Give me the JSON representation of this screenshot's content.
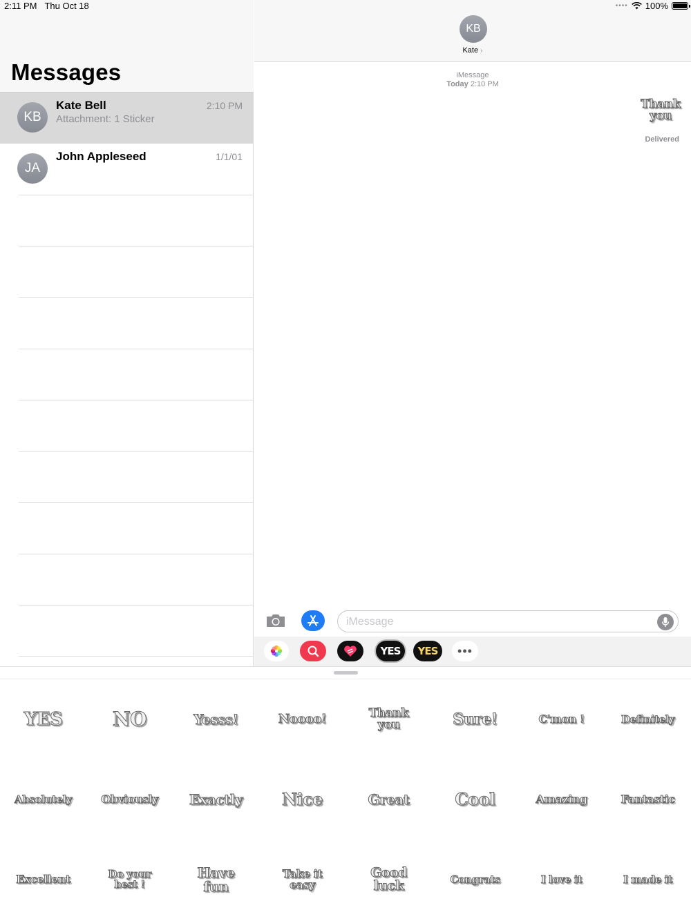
{
  "status": {
    "time": "2:11 PM",
    "date": "Thu Oct 18",
    "battery": "100%",
    "battery_level": 1.0
  },
  "sidebar": {
    "title": "Messages",
    "conversations": [
      {
        "initials": "KB",
        "name": "Kate Bell",
        "preview": "Attachment: 1 Sticker",
        "time": "2:10 PM",
        "selected": true
      },
      {
        "initials": "JA",
        "name": "John Appleseed",
        "preview": "",
        "time": "1/1/01",
        "selected": false
      }
    ]
  },
  "chat": {
    "contact_initials": "KB",
    "contact_name": "Kate",
    "service": "iMessage",
    "timestamp_day": "Today",
    "timestamp_time": "2:10 PM",
    "sticker_text": "Thank\nyou",
    "delivered": "Delivered"
  },
  "compose": {
    "placeholder": "iMessage"
  },
  "app_drawer": {
    "yes_1": "YES",
    "yes_2": "YES",
    "more": "•••"
  },
  "stickers": [
    "YES",
    "NO",
    "Yesss!",
    "Noooo!",
    "Thank\nyou",
    "Sure!",
    "C'mon !",
    "Definitely",
    "Absolutely",
    "Obviously",
    "Exactly",
    "Nice",
    "Great",
    "Cool",
    "Amazing",
    "Fantastic",
    "Excellent",
    "Do your\nbest !",
    "Have\nfun",
    "Take it\neasy",
    "Good\nluck",
    "Congrats",
    "I love it",
    "I made it"
  ],
  "colors": {
    "accent_blue": "#1e7cf5",
    "selected_row": "#d9d9d9",
    "gray_text": "#8e8e93"
  }
}
